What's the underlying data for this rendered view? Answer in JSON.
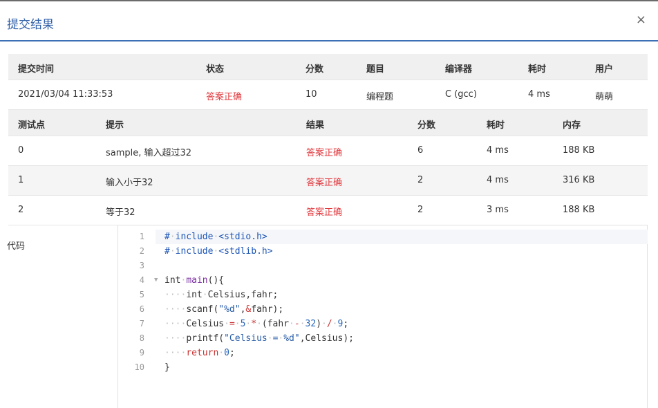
{
  "dialog": {
    "title": "提交结果",
    "close_label": "×"
  },
  "summary": {
    "headers": [
      "提交时间",
      "状态",
      "分数",
      "题目",
      "编译器",
      "耗时",
      "用户"
    ],
    "row": [
      "2021/03/04 11:33:53",
      "答案正确",
      "10",
      "编程题",
      "C (gcc)",
      "4 ms",
      "萌萌"
    ]
  },
  "tests": {
    "headers": [
      "测试点",
      "提示",
      "结果",
      "分数",
      "耗时",
      "内存"
    ],
    "rows": [
      [
        "0",
        "sample, 输入超过32",
        "答案正确",
        "6",
        "4 ms",
        "188 KB"
      ],
      [
        "1",
        "输入小于32",
        "答案正确",
        "2",
        "4 ms",
        "316 KB"
      ],
      [
        "2",
        "等于32",
        "答案正确",
        "2",
        "3 ms",
        "188 KB"
      ]
    ]
  },
  "code": {
    "label": "代码",
    "line_numbers": [
      "1",
      "2",
      "3",
      "4",
      "5",
      "6",
      "7",
      "8",
      "9",
      "10"
    ],
    "lines": [
      "# include <stdio.h>",
      "# include <stdlib.h>",
      "",
      "int main(){",
      "    int Celsius,fahr;",
      "    scanf(\"%d\",&fahr);",
      "    Celsius = 5 * (fahr - 32) / 9;",
      "    printf(\"Celsius = %d\",Celsius);",
      "    return 0;",
      "}"
    ]
  },
  "colors": {
    "accent": "#2f5fa8",
    "success": "#e0393e",
    "header_bg": "#f0f0f0"
  }
}
